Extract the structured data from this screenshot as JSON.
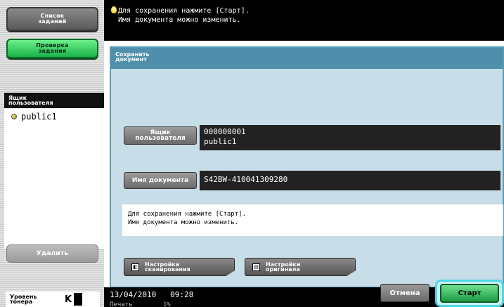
{
  "left_panel": {
    "job_list_label": "Список\nзаданий",
    "job_check_label": "Проверка\nзадания",
    "user_box_title": "Ящик\nпользователя",
    "user_box_item": "public1",
    "delete_label": "Удалить",
    "toner_label": "Уровень\nтонера",
    "toner_color": "K"
  },
  "top_message": {
    "line1": "Для сохранения нажмите [Старт].",
    "line2": "Имя документа можно изменить."
  },
  "panel": {
    "title": "Сохранить\nдокумент",
    "user_box_btn": "Ящик\nпользователя",
    "user_box_number": "000000001",
    "user_box_name": "public1",
    "doc_name_btn": "Имя документа",
    "doc_name_value": "S42BW-410041309280",
    "msg_line1": "Для сохранения нажмите [Старт].",
    "msg_line2": "Имя документа можно изменить.",
    "scan_settings_label": "Настройки\nсканирования",
    "original_settings_label": "Настройки\nоригинала"
  },
  "bottom": {
    "date": "13/04/2010",
    "time": "09:28",
    "print_label": "Печать",
    "print_value": "1%",
    "cancel_label": "Отмена",
    "start_label": "Старт"
  },
  "colors": {
    "accent_green": "#1bb34a",
    "panel_blue": "#c7dde7",
    "title_blue": "#4f8fab",
    "start_ring": "#4fd6e6"
  }
}
